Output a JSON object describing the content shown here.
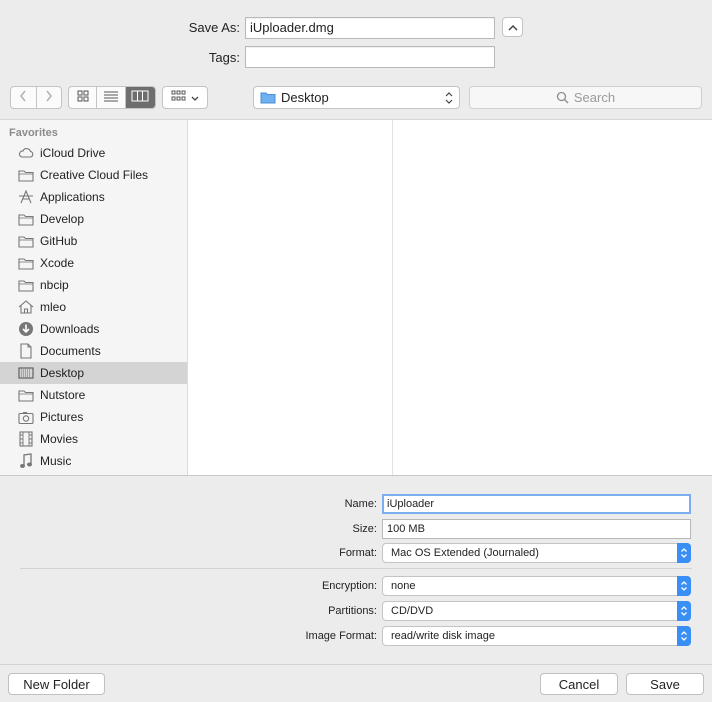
{
  "header": {
    "save_as_label": "Save As:",
    "save_as_value": "iUploader.dmg",
    "tags_label": "Tags:",
    "tags_value": ""
  },
  "toolbar": {
    "location": "Desktop",
    "search_placeholder": "Search",
    "icons": [
      "back-icon",
      "forward-icon",
      "icon-view-icon",
      "list-view-icon",
      "column-view-icon",
      "group-view-icon"
    ]
  },
  "sidebar": {
    "heading": "Favorites",
    "items": [
      {
        "label": "iCloud Drive",
        "icon": "cloud-icon"
      },
      {
        "label": "Creative Cloud Files",
        "icon": "folder-icon"
      },
      {
        "label": "Applications",
        "icon": "applications-icon"
      },
      {
        "label": "Develop",
        "icon": "folder-icon"
      },
      {
        "label": "GitHub",
        "icon": "folder-icon"
      },
      {
        "label": "Xcode",
        "icon": "folder-icon"
      },
      {
        "label": "nbcip",
        "icon": "folder-icon"
      },
      {
        "label": "mleo",
        "icon": "home-icon"
      },
      {
        "label": "Downloads",
        "icon": "downloads-icon"
      },
      {
        "label": "Documents",
        "icon": "documents-icon"
      },
      {
        "label": "Desktop",
        "icon": "desktop-icon",
        "selected": true
      },
      {
        "label": "Nutstore",
        "icon": "folder-icon"
      },
      {
        "label": "Pictures",
        "icon": "pictures-icon"
      },
      {
        "label": "Movies",
        "icon": "movies-icon"
      },
      {
        "label": "Music",
        "icon": "music-icon"
      }
    ]
  },
  "options": {
    "name_label": "Name:",
    "name_value": "iUploader",
    "size_label": "Size:",
    "size_value": "100 MB",
    "format_label": "Format:",
    "format_value": "Mac OS Extended (Journaled)",
    "encryption_label": "Encryption:",
    "encryption_value": "none",
    "partitions_label": "Partitions:",
    "partitions_value": "CD/DVD",
    "image_format_label": "Image Format:",
    "image_format_value": "read/write disk image"
  },
  "footer": {
    "new_folder": "New Folder",
    "cancel": "Cancel",
    "save": "Save"
  },
  "colors": {
    "accent": "#3a8ff7",
    "selected_row": "#d4d4d4",
    "background": "#ececec"
  }
}
